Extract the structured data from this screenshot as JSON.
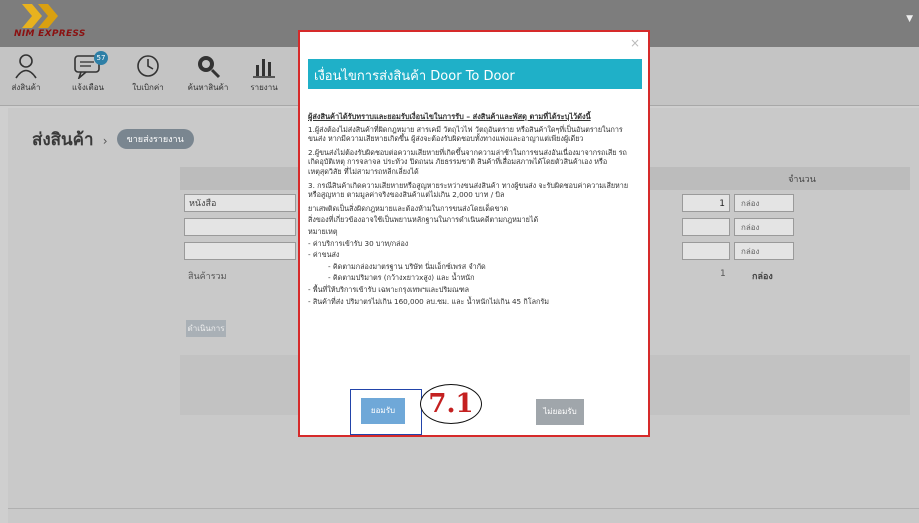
{
  "app": {
    "logo_text": "NIM EXPRESS"
  },
  "nav": {
    "items": [
      {
        "label": "ส่งสินค้า",
        "icon": "person-icon"
      },
      {
        "label": "แจ้งเตือน",
        "icon": "chat-icon",
        "badge": "57"
      },
      {
        "label": "ใบเบิกค่า",
        "icon": "clock-icon"
      },
      {
        "label": "ค้นหาสินค้า",
        "icon": "search-icon"
      },
      {
        "label": "รายงาน",
        "icon": "chart-icon"
      }
    ]
  },
  "page": {
    "title": "ส่งสินค้า",
    "breadcrumb_sep": "›",
    "breadcrumb_btn": "ขายส่งรายงาน"
  },
  "table": {
    "qty_header": "จำนวน",
    "rows": [
      {
        "name": "หนังสือ",
        "qty": "1",
        "unit": "กล่อง"
      },
      {
        "name": "",
        "qty": "",
        "unit": "กล่อง"
      },
      {
        "name": "",
        "qty": "",
        "unit": "กล่อง"
      }
    ],
    "total_label": "สินค้ารวม",
    "total_qty": "1",
    "total_unit": "กล่อง",
    "next_label": "ดำเนินการ"
  },
  "modal": {
    "close": "×",
    "title": "เงื่อนไขการส่งสินค้า Door To Door",
    "heading": "ผู้ส่งสินค้าได้รับทราบและยอมรับเงื่อนไขในการรับ – ส่งสินค้าและพัสดุ ตามที่ได้ระบุไว้ดังนี้",
    "para1": "1.ผู้ส่งต้องไม่ส่งสินค้าที่ผิดกฎหมาย สารเคมี วัตถุไวไฟ วัตถุอันตราย หรือสินค้าใดๆที่เป็นอันตรายในการขนส่ง หากมีความเสียหายเกิดขึ้น ผู้ส่งจะต้องรับผิดชอบทั้งทางแพ่งและอาญาแต่เพียงผู้เดียว",
    "para2": "2.ผู้ขนส่งไม่ต้องรับผิดชอบต่อความเสียหายที่เกิดขึ้นจากความล่าช้าในการขนส่งอันเนื่องมาจากรถเสีย รถเกิดอุบัติเหตุ การจลาจล ประท้วง ปิดถนน ภัยธรรมชาติ สินค้าที่เสื่อมสภาพได้โดยตัวสินค้าเอง หรือเหตุสุดวิสัย ที่ไม่สามารถหลีกเลี่ยงได้",
    "para3": "3. กรณีสินค้าเกิดความเสียหายหรือสูญหายระหว่างขนส่งสินค้า ทางผู้ขนส่ง จะรับผิดชอบค่าความเสียหายหรือสูญหาย ตามมูลค่าจริงของสินค้าแต่ไม่เกิน 2,000 บาท / บิล",
    "para4": "ยาเสพติดเป็นสิ่งผิดกฎหมายและต้องห้ามในการขนส่งโดยเด็ดขาด",
    "para5": "สิ่งของที่เกี่ยวข้องอาจใช้เป็นพยานหลักฐานในการดำเนินคดีตามกฎหมายได้",
    "note_head": "หมายเหตุ",
    "note1": "- ค่าบริการเข้ารับ 30 บาท/กล่อง",
    "note2": "- ค่าขนส่ง",
    "note2a": "- คิดตามกล่องมาตรฐาน บริษัท นิ่มเอ็กซ์เพรส จำกัด",
    "note2b": "- คิดตามปริมาตร (กว้างxยาวxสูง) และ น้ำหนัก",
    "note3": "- พื้นที่ให้บริการเข้ารับ เฉพาะกรุงเทพฯและปริมณฑล",
    "note4": "- สินค้าที่ส่ง ปริมาตรไม่เกิน 160,000 ลบ.ซม. และ น้ำหนักไม่เกิน 45 กิโลกรัม",
    "accept_label": "ยอมรับ",
    "decline_label": "ไม่ยอมรับ",
    "step_label": "7.1"
  },
  "colors": {
    "header_teal": "#1fb0c8",
    "modal_border": "#d62a2a",
    "accept_blue": "#6fa8d8",
    "step_red": "#c42020"
  }
}
